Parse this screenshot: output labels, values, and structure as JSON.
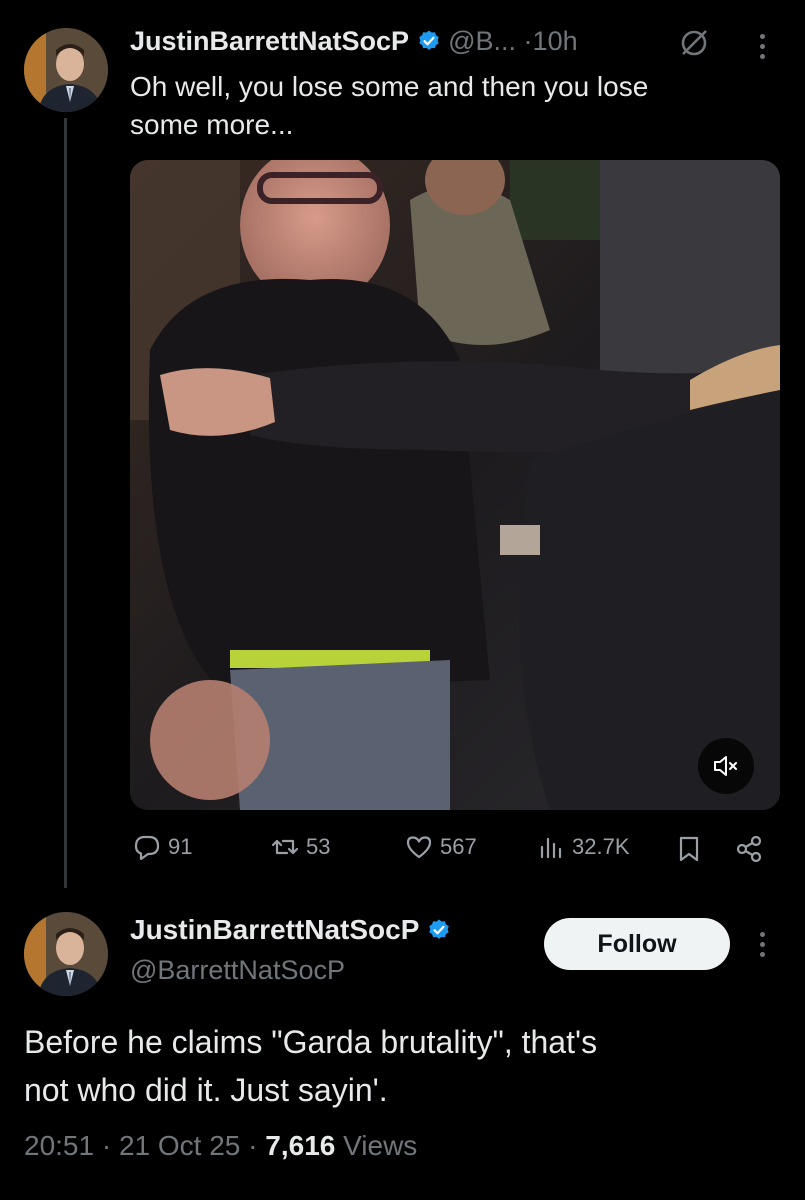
{
  "post1": {
    "display_name": "JustinBarrettNatSocP",
    "handle": "@B...",
    "separator": "·",
    "time": "10h",
    "text_line1": "Oh well, you lose some and then you lose",
    "text_line2": "some more...",
    "actions": {
      "replies": "91",
      "reposts": "53",
      "likes": "567",
      "views": "32.7K"
    }
  },
  "post2": {
    "display_name": "JustinBarrettNatSocP",
    "handle": "@BarrettNatSocP",
    "follow_label": "Follow",
    "text_line1": "Before he claims \"Garda brutality\", that's",
    "text_line2": "not who did it. Just sayin'.",
    "time": "20:51",
    "sep1": " · ",
    "date": "21 Oct 25",
    "sep2": " · ",
    "views_count": "7,616",
    "views_label": " Views"
  },
  "colors": {
    "background": "#000000",
    "verified_blue": "#1d9bf0",
    "muted_text": "#71767b"
  }
}
